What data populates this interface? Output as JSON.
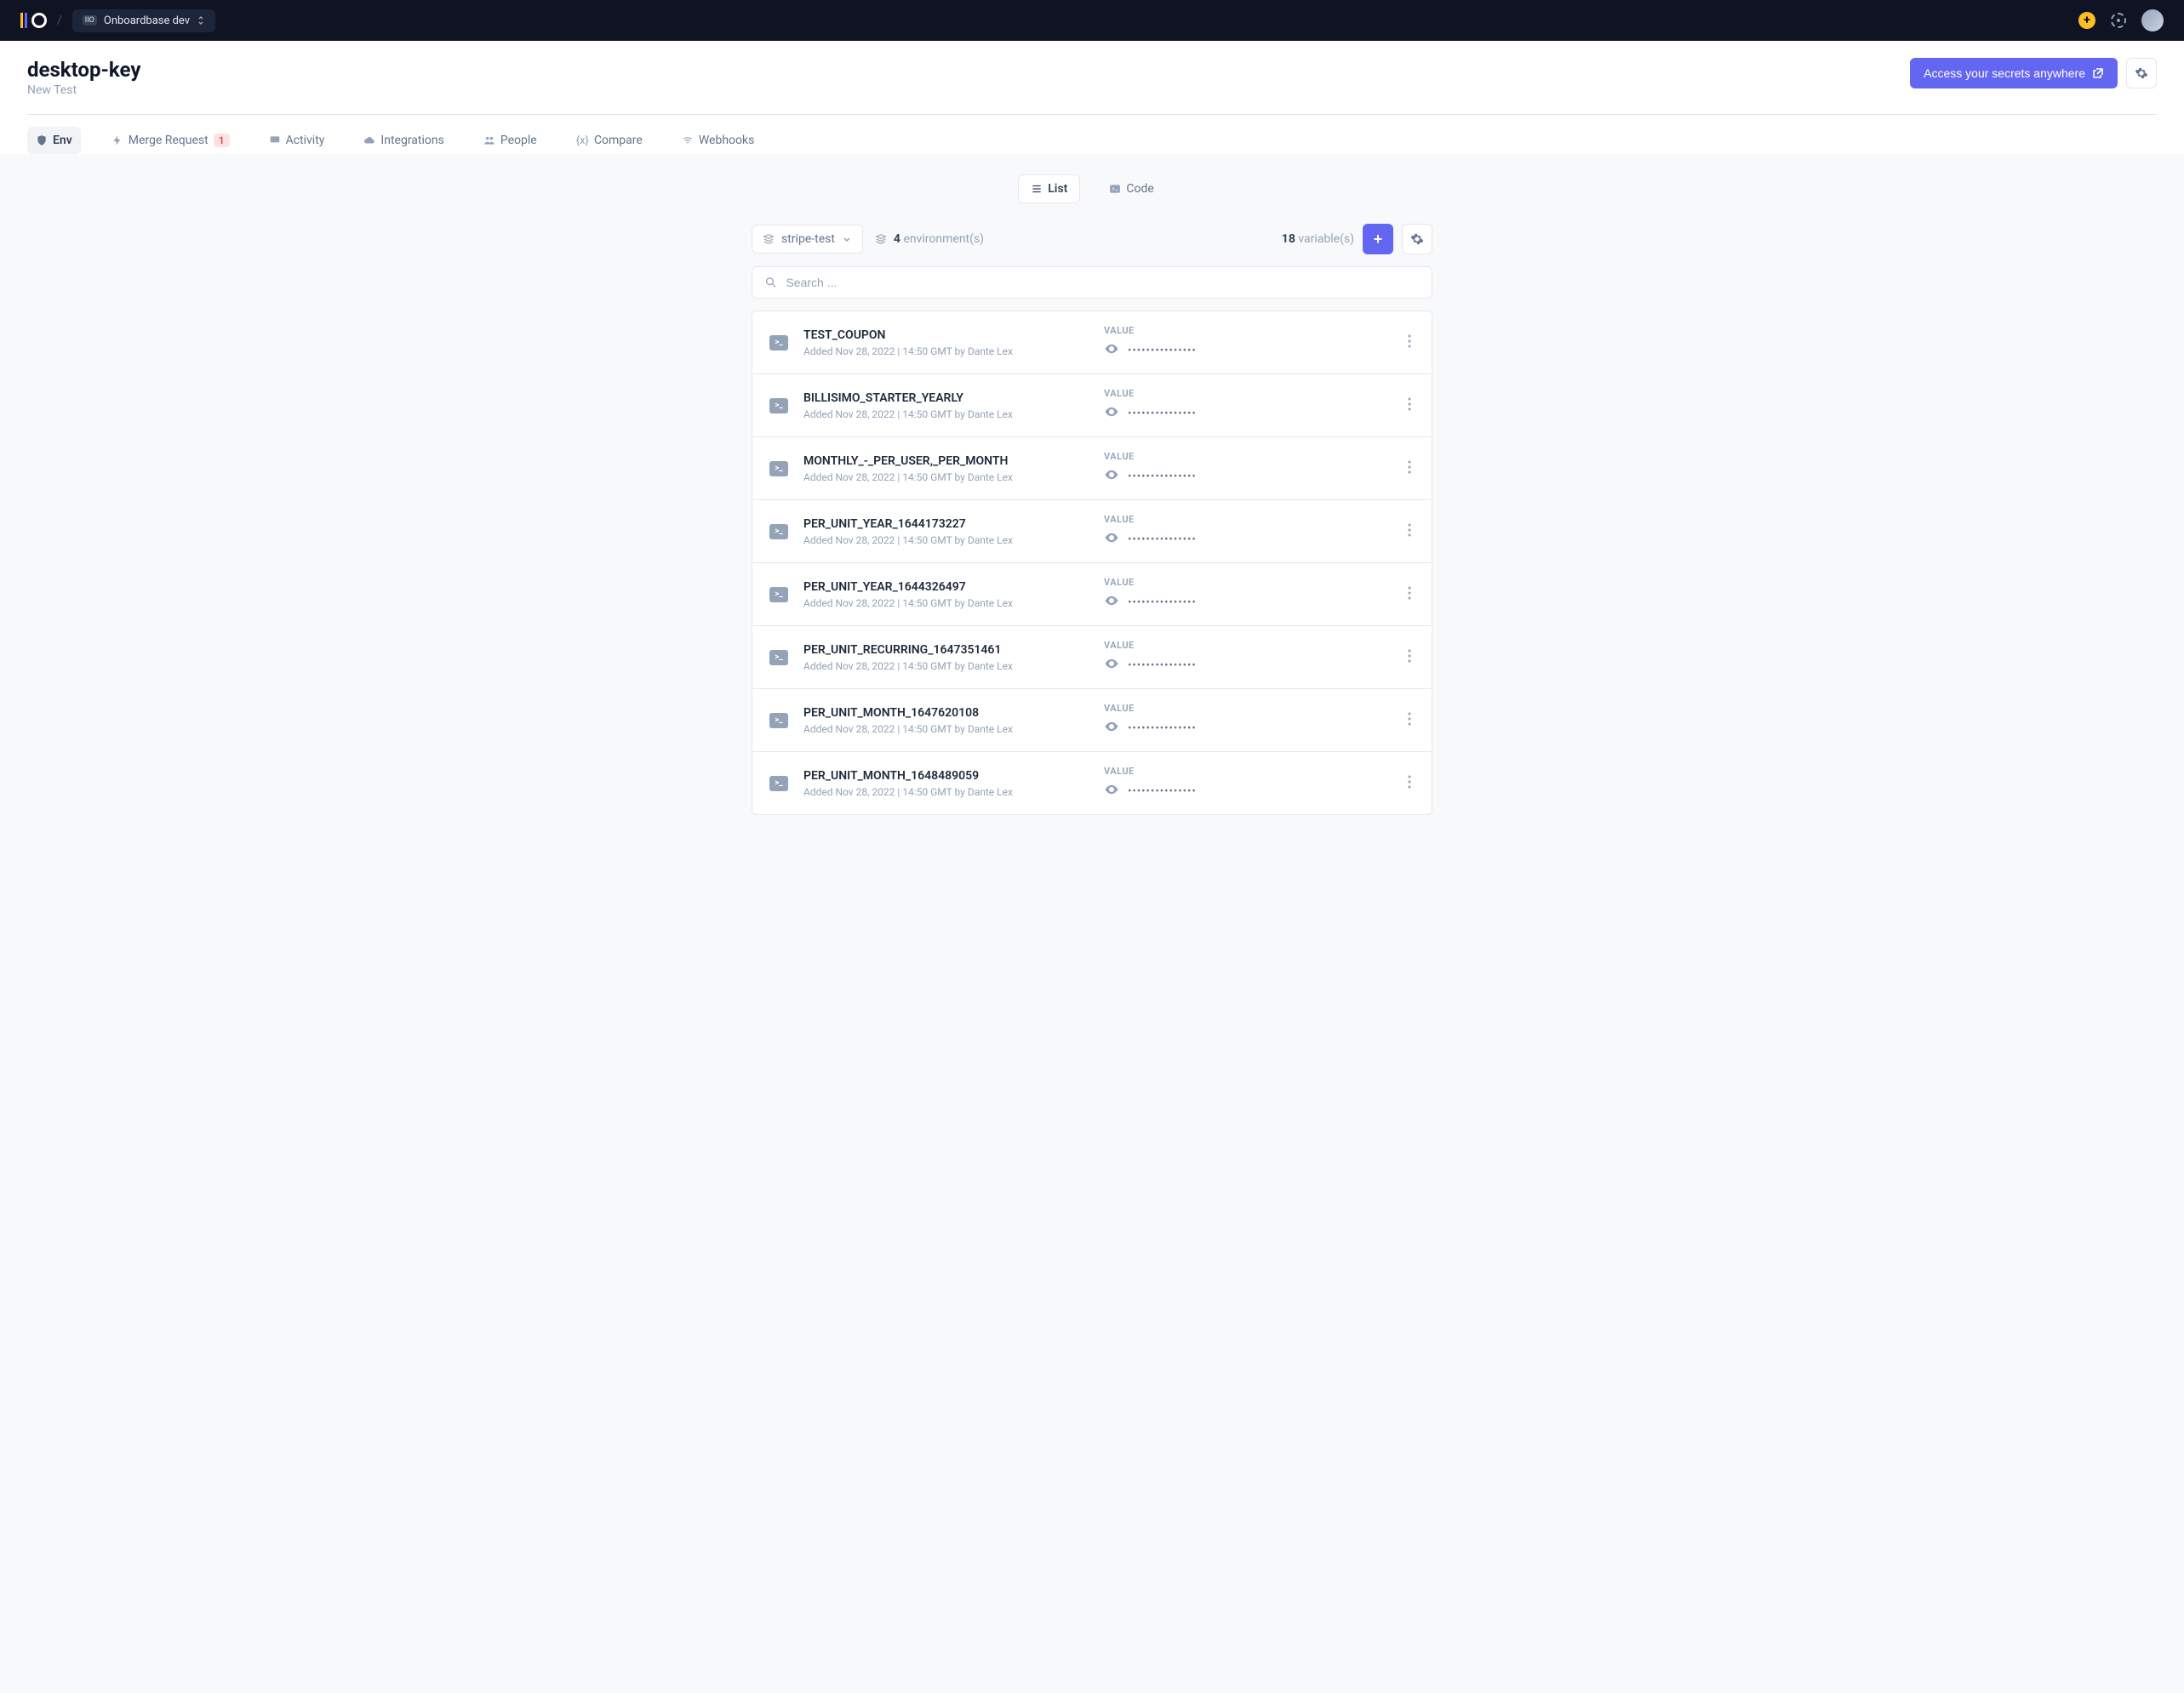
{
  "topbar": {
    "org_name": "Onboardbase dev"
  },
  "header": {
    "title": "desktop-key",
    "subtitle": "New Test",
    "access_button": "Access your secrets anywhere"
  },
  "tabs": [
    {
      "label": "Env",
      "active": true
    },
    {
      "label": "Merge Request",
      "badge": "1"
    },
    {
      "label": "Activity"
    },
    {
      "label": "Integrations"
    },
    {
      "label": "People"
    },
    {
      "label": "Compare"
    },
    {
      "label": "Webhooks"
    }
  ],
  "view": {
    "list": "List",
    "code": "Code"
  },
  "env": {
    "selected": "stripe-test",
    "count": "4",
    "count_label": "environment(s)"
  },
  "vars": {
    "count": "18",
    "count_label": "variable(s)"
  },
  "search": {
    "placeholder": "Search ..."
  },
  "value_header": "VALUE",
  "rows": [
    {
      "name": "TEST_COUPON",
      "meta": "Added Nov 28, 2022 | 14:50 GMT by Dante Lex",
      "masked": "•••••••••••••••"
    },
    {
      "name": "BILLISIMO_STARTER_YEARLY",
      "meta": "Added Nov 28, 2022 | 14:50 GMT by Dante Lex",
      "masked": "•••••••••••••••"
    },
    {
      "name": "MONTHLY_-_PER_USER,_PER_MONTH",
      "meta": "Added Nov 28, 2022 | 14:50 GMT by Dante Lex",
      "masked": "•••••••••••••••"
    },
    {
      "name": "PER_UNIT_YEAR_1644173227",
      "meta": "Added Nov 28, 2022 | 14:50 GMT by Dante Lex",
      "masked": "•••••••••••••••"
    },
    {
      "name": "PER_UNIT_YEAR_1644326497",
      "meta": "Added Nov 28, 2022 | 14:50 GMT by Dante Lex",
      "masked": "•••••••••••••••"
    },
    {
      "name": "PER_UNIT_RECURRING_1647351461",
      "meta": "Added Nov 28, 2022 | 14:50 GMT by Dante Lex",
      "masked": "•••••••••••••••"
    },
    {
      "name": "PER_UNIT_MONTH_1647620108",
      "meta": "Added Nov 28, 2022 | 14:50 GMT by Dante Lex",
      "masked": "•••••••••••••••"
    },
    {
      "name": "PER_UNIT_MONTH_1648489059",
      "meta": "Added Nov 28, 2022 | 14:50 GMT by Dante Lex",
      "masked": "•••••••••••••••"
    }
  ]
}
